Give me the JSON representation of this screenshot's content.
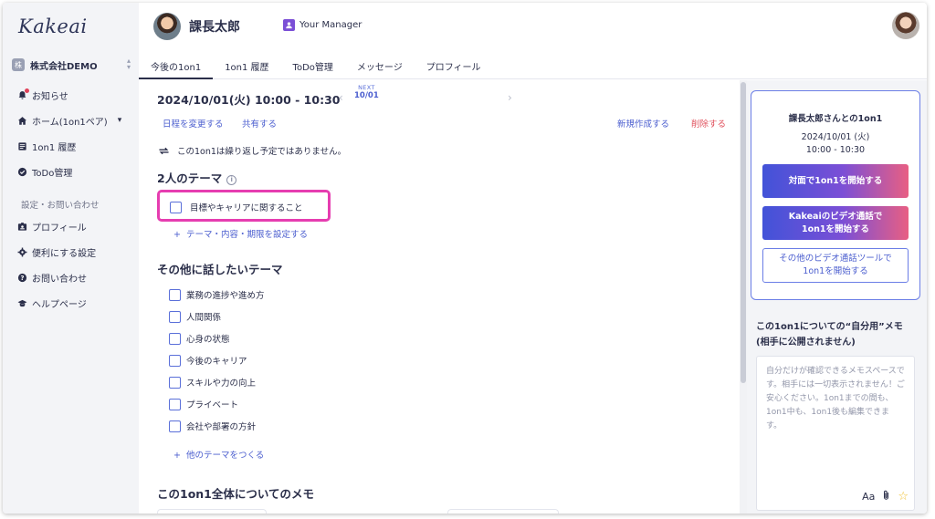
{
  "sidebar": {
    "logo": "Kakeai",
    "company_badge": "株",
    "company": "株式会社DEMO",
    "company_switch_icon": "updown-chevron-icon",
    "items": [
      {
        "label": "お知らせ",
        "icon": "bell-icon"
      },
      {
        "label": "ホーム(1on1ペア)",
        "icon": "home-icon"
      },
      {
        "label": "1on1 履歴",
        "icon": "history-icon"
      },
      {
        "label": "ToDo管理",
        "icon": "check-circle-icon"
      }
    ],
    "section_label": "設定・お問い合わせ",
    "settings": [
      {
        "label": "プロフィール",
        "icon": "id-card-icon"
      },
      {
        "label": "便利にする設定",
        "icon": "gear-icon"
      },
      {
        "label": "お問い合わせ",
        "icon": "question-icon"
      },
      {
        "label": "ヘルプページ",
        "icon": "graduation-cap-icon"
      }
    ]
  },
  "header": {
    "user_name": "課長太郎",
    "role_badge": "Your Manager",
    "tabs": [
      "今後の1on1",
      "1on1 履歴",
      "ToDo管理",
      "メッセージ",
      "プロフィール"
    ],
    "active_tab": 0
  },
  "meeting": {
    "datetime": "2024/10/01(火) 10:00 - 10:30",
    "next_label": "NEXT",
    "next_date": "10/01",
    "reschedule": "日程を変更する",
    "share": "共有する",
    "new": "新規作成する",
    "delete": "削除する",
    "repeat_note": "この1on1は繰り返し予定ではありません。"
  },
  "themes": {
    "title": "2人のテーマ",
    "items": [
      "目標やキャリアに関すること"
    ],
    "set_link": "テーマ・内容・期限を設定する"
  },
  "other_topics": {
    "title": "その他に話したいテーマ",
    "items": [
      "業務の進捗や進め方",
      "人間関係",
      "心身の状態",
      "今後のキャリア",
      "スキルや力の向上",
      "プライベート",
      "会社や部署の方針"
    ],
    "add_link": "他のテーマをつくる"
  },
  "overall_memo": {
    "title": "この1on1全体についてのメモ"
  },
  "card": {
    "title": "課長太郎さんとの1on1",
    "date": "2024/10/01 (火)",
    "time": "10:00 - 10:30",
    "btn_inperson": "対面で1on1を開始する",
    "btn_video_l1": "Kakeaiのビデオ通話で",
    "btn_video_l2": "1on1を開始する",
    "btn_other_l1": "その他のビデオ通話ツールで",
    "btn_other_l2": "1on1を開始する"
  },
  "private_memo": {
    "title_l1": "この1on1についての“自分用”メモ",
    "title_l2": "(相手に公開されません)",
    "placeholder": "自分だけが確認できるメモスペースです。相手には一切表示されません！ご安心ください。1on1までの間も、1on1中も、1on1後も編集できます。",
    "tools": {
      "font": "Aa",
      "attach_icon": "paperclip-icon",
      "star_icon": "star-icon"
    }
  },
  "colors": {
    "accent": "#4b5ecf",
    "danger": "#e0505c",
    "highlight": "#e63db0",
    "text": "#2b2f4a"
  }
}
